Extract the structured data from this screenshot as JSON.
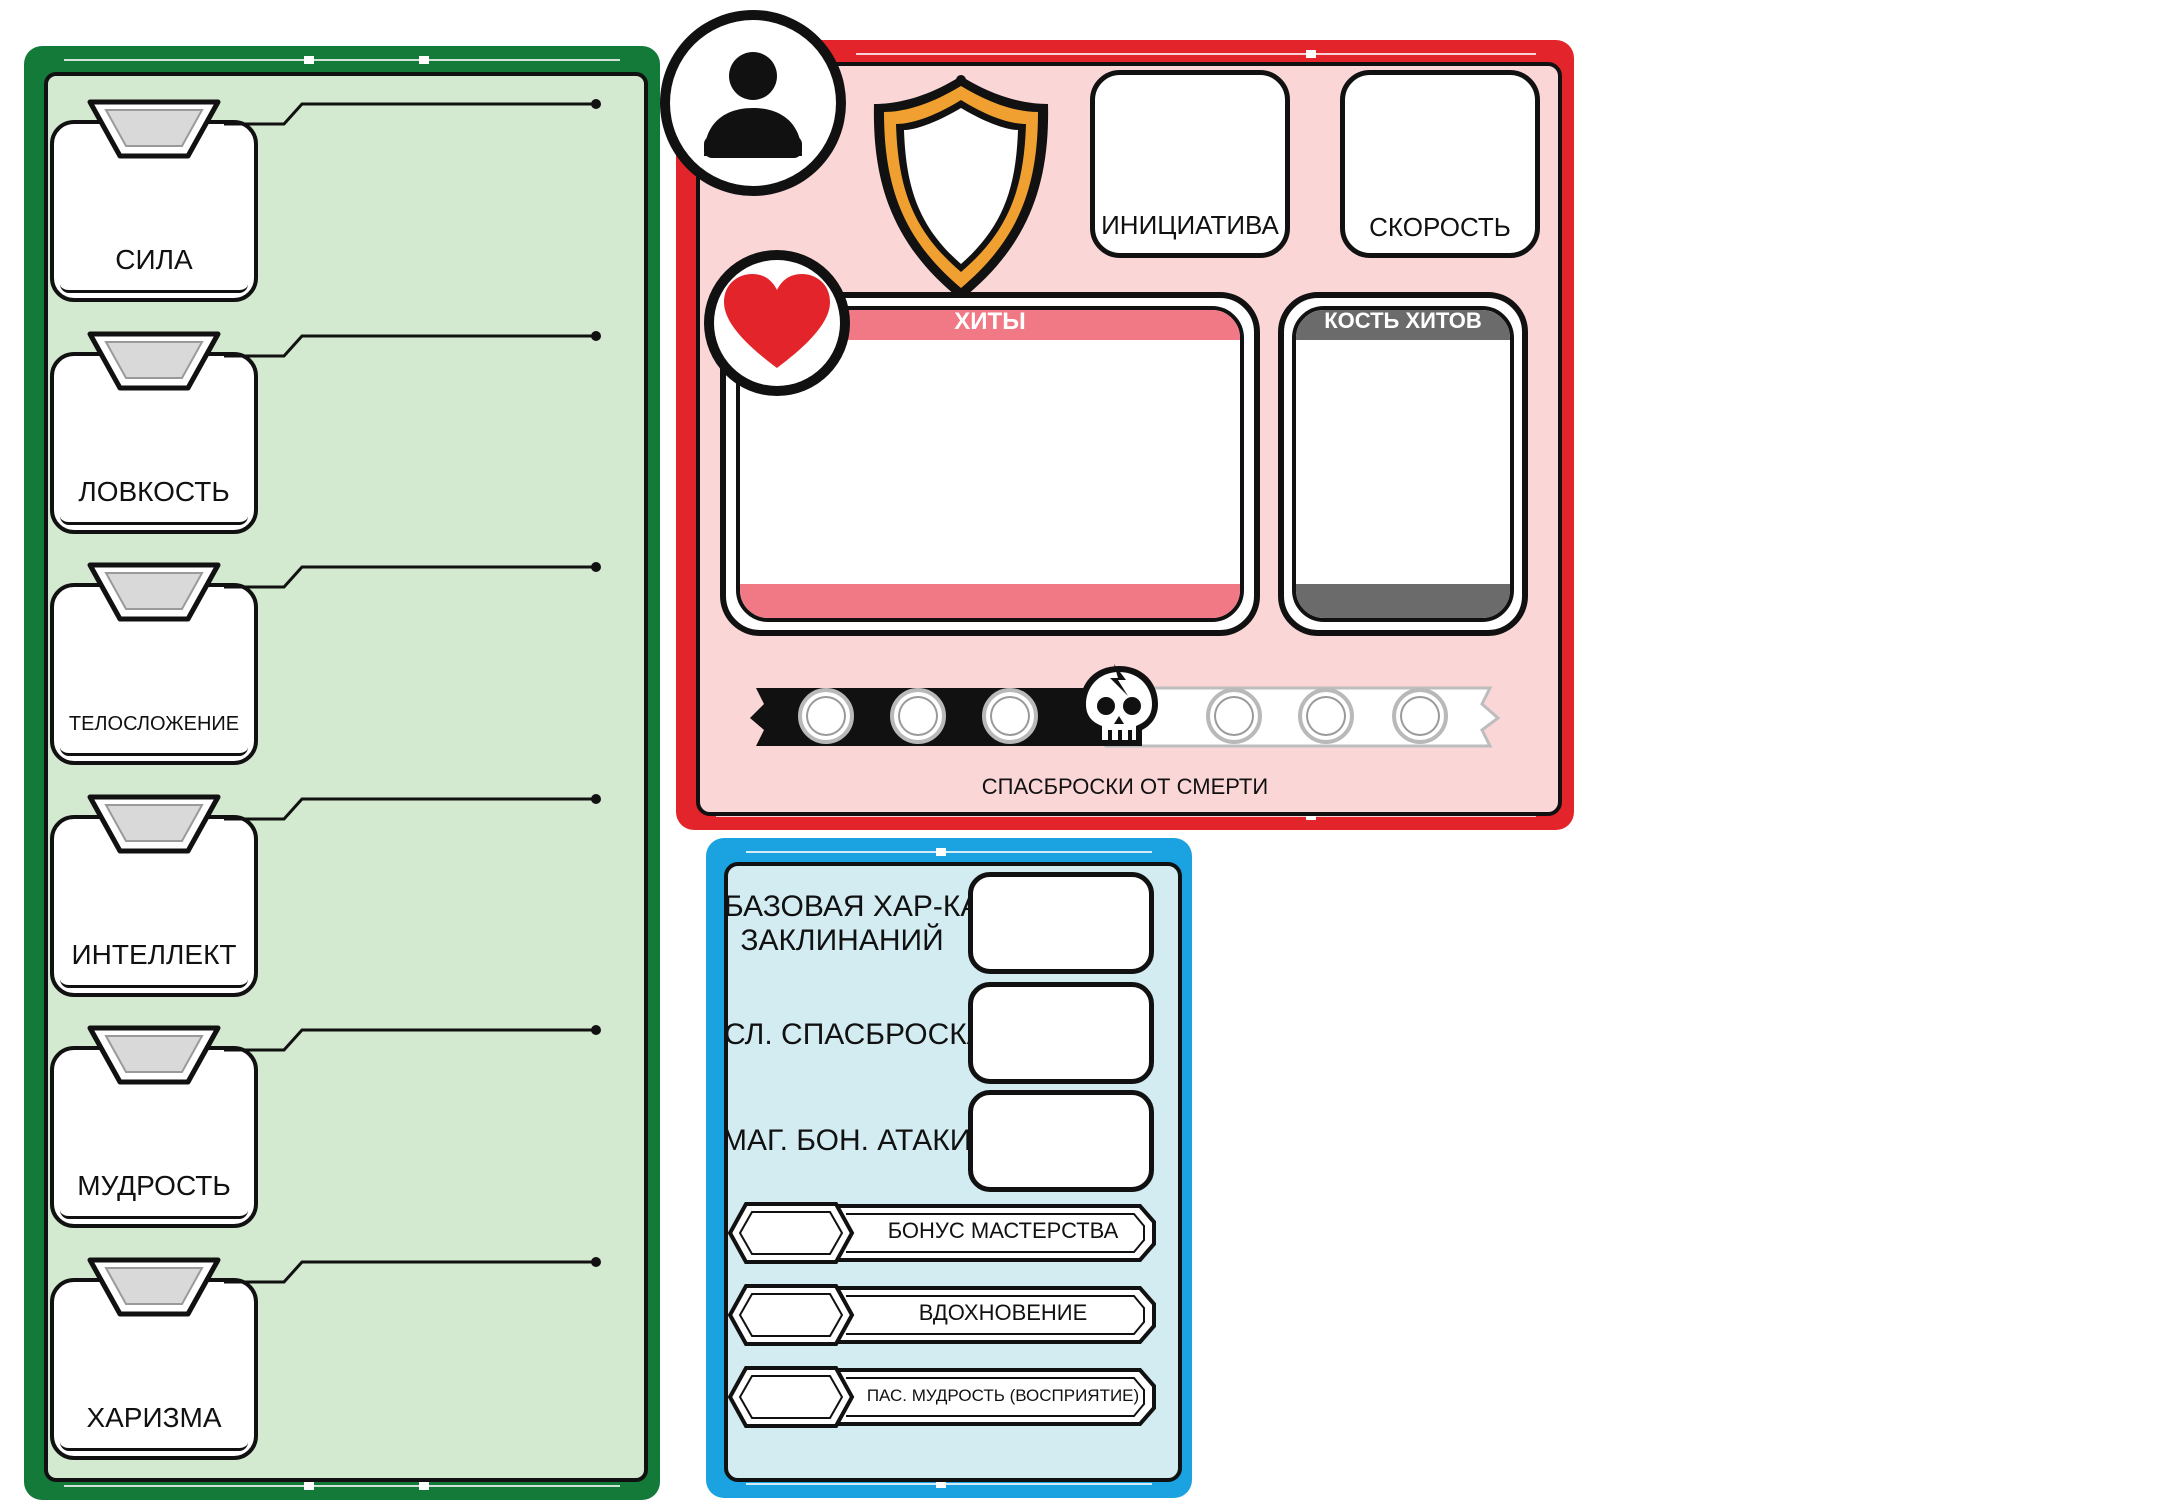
{
  "abilities": {
    "items": [
      {
        "label": "СИЛА"
      },
      {
        "label": "ЛОВКОСТЬ"
      },
      {
        "label": "ТЕЛОСЛОЖЕНИЕ"
      },
      {
        "label": "ИНТЕЛЛЕКТ"
      },
      {
        "label": "МУДРОСТЬ"
      },
      {
        "label": "ХАРИЗМА"
      }
    ]
  },
  "combat": {
    "portrait_icon": "user-icon",
    "armor_icon": "shield-icon",
    "initiative_label": "ИНИЦИАТИВА",
    "speed_label": "СКОРОСТЬ",
    "hp_icon": "heart-icon",
    "hp_label": "ХИТЫ",
    "hit_dice_label": "КОСТЬ ХИТОВ",
    "death_saves_label": "СПАСБРОСКИ ОТ СМЕРТИ",
    "death_icon": "skull-icon"
  },
  "spellcasting": {
    "ability_label_line1": "БАЗОВАЯ ХАР-КА",
    "ability_label_line2": "ЗАКЛИНАНИЙ",
    "save_dc_label": "СЛ. СПАСБРОСКА",
    "attack_bonus_label": "МАГ. БОН. АТАКИ"
  },
  "misc": {
    "proficiency_label": "БОНУС МАСТЕРСТВА",
    "inspiration_label": "ВДОХНОВЕНИЕ",
    "passive_wisdom_label": "ПАС. МУДРОСТЬ (ВОСПРИЯТИЕ)"
  },
  "colors": {
    "green_frame": "#137a3a",
    "green_fill": "#d3e9d0",
    "red_frame": "#e3252b",
    "red_fill": "#fad6d7",
    "blue_frame": "#1aa3e0",
    "blue_fill": "#d3ecf2",
    "hp_bar": "#f07985",
    "hit_dice_bar": "#6b6b6b",
    "armor_outline": "#f0a030"
  }
}
